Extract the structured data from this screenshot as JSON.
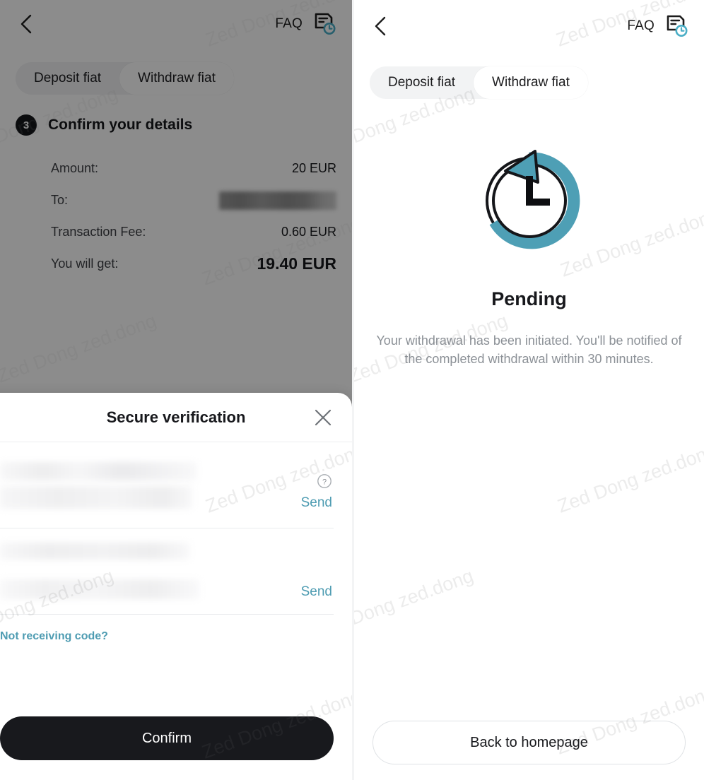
{
  "screens": [
    {
      "id": "confirm-details",
      "topbar": {
        "back_icon": "chevron-left-icon",
        "faq_label": "FAQ",
        "history_icon": "document-clock-icon"
      },
      "tabs": [
        {
          "label": "Deposit fiat",
          "active": false
        },
        {
          "label": "Withdraw fiat",
          "active": true
        }
      ],
      "details": {
        "step_number": "3",
        "title": "Confirm your details",
        "rows": [
          {
            "label": "Amount:",
            "value": "20 EUR",
            "redacted": false,
            "emphasis": false
          },
          {
            "label": "To:",
            "value": "",
            "redacted": true,
            "emphasis": false
          },
          {
            "label": "Transaction Fee:",
            "value": "0.60 EUR",
            "redacted": false,
            "emphasis": false
          },
          {
            "label": "You will get:",
            "value": "19.40 EUR",
            "redacted": false,
            "emphasis": true
          }
        ]
      },
      "modal": {
        "title": "Secure verification",
        "close_icon": "close-icon",
        "help_icon": "help-circle-icon",
        "field_one": {
          "value": "",
          "send_label": "Send",
          "redacted": true
        },
        "field_two": {
          "value": "",
          "send_label": "Send",
          "redacted": true
        },
        "not_receiving_label": "Not receiving code?",
        "confirm_label": "Confirm"
      }
    },
    {
      "id": "pending-status",
      "topbar": {
        "back_icon": "chevron-left-icon",
        "faq_label": "FAQ",
        "history_icon": "document-clock-icon"
      },
      "tabs": [
        {
          "label": "Deposit fiat",
          "active": false
        },
        {
          "label": "Withdraw fiat",
          "active": true
        }
      ],
      "status": {
        "icon": "pending-clock-icon",
        "title": "Pending",
        "description": "Your withdrawal has been initiated. You'll be notified of the completed withdrawal within 30 minutes.",
        "back_home_label": "Back to homepage"
      }
    }
  ],
  "colors": {
    "accent_teal": "#4e9cb2",
    "text_primary": "#17181c",
    "text_secondary": "#8b9096",
    "button_dark": "#18191d",
    "tab_track": "#f2f3f4"
  },
  "watermark": {
    "text_a": "Zed Dong zed.dong",
    "text_b": "Dong zed.dong",
    "text_c": "Zed Dong zed.dong"
  }
}
